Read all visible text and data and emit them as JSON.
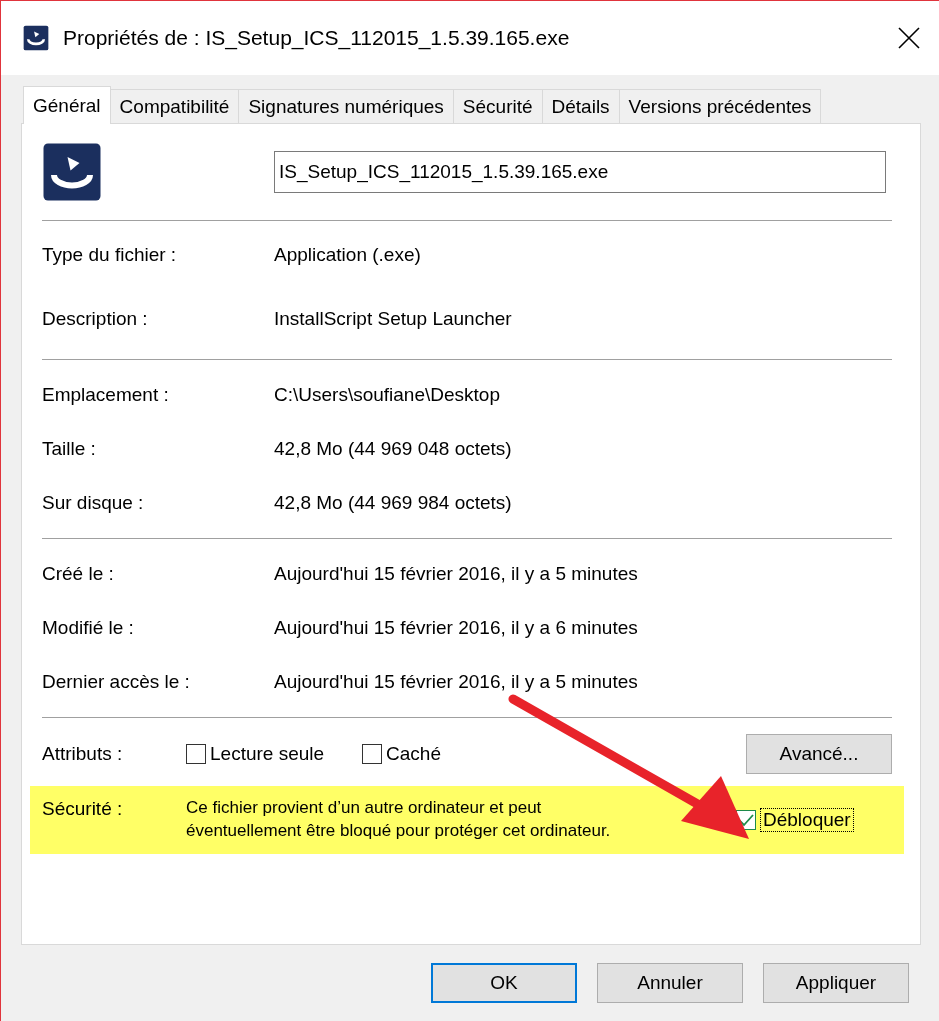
{
  "window": {
    "title": "Propriétés de : IS_Setup_ICS_112015_1.5.39.165.exe"
  },
  "tabs": [
    {
      "label": "Général",
      "selected": true
    },
    {
      "label": "Compatibilité",
      "selected": false
    },
    {
      "label": "Signatures numériques",
      "selected": false
    },
    {
      "label": "Sécurité",
      "selected": false
    },
    {
      "label": "Détails",
      "selected": false
    },
    {
      "label": "Versions précédentes",
      "selected": false
    }
  ],
  "file_name": "IS_Setup_ICS_112015_1.5.39.165.exe",
  "sections": [
    [
      {
        "label": "Type du fichier :",
        "value": "Application (.exe)"
      },
      {
        "label": "Description :",
        "value": "InstallScript Setup Launcher"
      }
    ],
    [
      {
        "label": "Emplacement :",
        "value": "C:\\Users\\soufiane\\Desktop"
      },
      {
        "label": "Taille :",
        "value": "42,8 Mo (44 969 048 octets)"
      },
      {
        "label": "Sur disque :",
        "value": "42,8 Mo (44 969 984 octets)"
      }
    ],
    [
      {
        "label": "Créé le :",
        "value": "Aujourd'hui 15 février 2016, il y a 5 minutes"
      },
      {
        "label": "Modifié le :",
        "value": "Aujourd'hui 15 février 2016, il y a 6 minutes"
      },
      {
        "label": "Dernier accès le :",
        "value": "Aujourd'hui 15 février 2016, il y a 5 minutes"
      }
    ]
  ],
  "attributes": {
    "label": "Attributs :",
    "checkboxes": [
      {
        "label": "Lecture seule",
        "checked": false
      },
      {
        "label": "Caché",
        "checked": false
      }
    ],
    "button": "Avancé..."
  },
  "security": {
    "label": "Sécurité :",
    "text": "Ce fichier provient d’un autre ordinateur et peut\néventuellement être bloqué pour protéger cet ordinateur.",
    "checkbox": {
      "label": "Débloquer",
      "checked": true
    }
  },
  "buttons": [
    {
      "label": "OK",
      "selected": true
    },
    {
      "label": "Annuler",
      "selected": false
    },
    {
      "label": "Appliquer",
      "selected": false
    }
  ]
}
